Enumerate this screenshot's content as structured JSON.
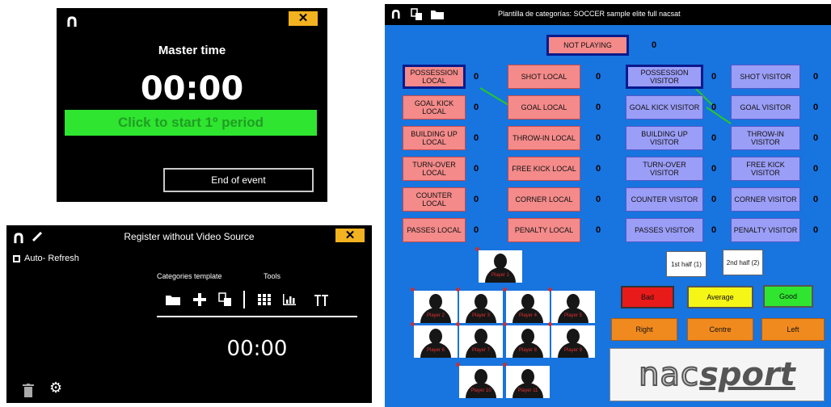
{
  "master": {
    "logo": "∩",
    "close": "✕",
    "title": "Master time",
    "clock": "00:00",
    "start_button": "Click to start 1º period",
    "end_button": "End of event"
  },
  "register": {
    "logo": "∩",
    "close": "✕",
    "title": "Register without Video Source",
    "auto_refresh": "Auto- Refresh",
    "categories_template": "Categories template",
    "tools": "Tools",
    "clock": "00:00",
    "icons": [
      "folder-icon",
      "plus-icon",
      "copy-icon",
      "grid-icon",
      "bar-chart-icon",
      "antenna-icon",
      "trash-icon",
      "gear-icon"
    ]
  },
  "template": {
    "title": "Plantilla de categorías: SOCCER sample elite full nacsat",
    "not_playing": {
      "label": "NOT PLAYING",
      "count": "0"
    },
    "local_a": [
      {
        "label": "POSSESSION LOCAL",
        "count": "0"
      },
      {
        "label": "GOAL KICK LOCAL",
        "count": "0"
      },
      {
        "label": "BUILDING UP LOCAL",
        "count": "0"
      },
      {
        "label": "TURN-OVER LOCAL",
        "count": "0"
      },
      {
        "label": "COUNTER LOCAL",
        "count": "0"
      },
      {
        "label": "PASSES LOCAL",
        "count": "0"
      }
    ],
    "local_b": [
      {
        "label": "SHOT LOCAL",
        "count": "0"
      },
      {
        "label": "GOAL LOCAL",
        "count": "0"
      },
      {
        "label": "THROW-IN LOCAL",
        "count": "0"
      },
      {
        "label": "FREE KICK LOCAL",
        "count": "0"
      },
      {
        "label": "CORNER LOCAL",
        "count": "0"
      },
      {
        "label": "PENALTY LOCAL",
        "count": "0"
      }
    ],
    "visitor_a": [
      {
        "label": "POSSESSION VISITOR",
        "count": "0"
      },
      {
        "label": "GOAL KICK VISITOR",
        "count": "0"
      },
      {
        "label": "BUILDING UP VISITOR",
        "count": "0"
      },
      {
        "label": "TURN-OVER VISITOR",
        "count": "0"
      },
      {
        "label": "COUNTER VISITOR",
        "count": "0"
      },
      {
        "label": "PASSES VISITOR",
        "count": "0"
      }
    ],
    "visitor_b": [
      {
        "label": "SHOT VISITOR",
        "count": "0"
      },
      {
        "label": "GOAL VISITOR",
        "count": "0"
      },
      {
        "label": "THROW-IN VISITOR",
        "count": "0"
      },
      {
        "label": "FREE KICK VISITOR",
        "count": "0"
      },
      {
        "label": "CORNER VISITOR",
        "count": "0"
      },
      {
        "label": "PENALTY VISITOR",
        "count": "0"
      }
    ],
    "first_half": "1st half (1)",
    "second_half": "2nd half (2)",
    "ratings": [
      {
        "label": "Bad",
        "color": "#e81a1a"
      },
      {
        "label": "Average",
        "color": "#f5f516"
      },
      {
        "label": "Good",
        "color": "#2fe52f"
      }
    ],
    "positions": [
      "Right",
      "Centre",
      "Left"
    ],
    "players": [
      "Player 1",
      "Player 2",
      "Player 3",
      "Player 4",
      "Player 5",
      "Player 6",
      "Player 7",
      "Player 8",
      "Player 9",
      "Player 10",
      "Player 11"
    ],
    "brand": {
      "prefix": "nac",
      "suffix": "sport"
    },
    "colors": {
      "background": "#1874de",
      "local": "#f48a8a",
      "visitor": "#9b9ef7",
      "position": "#f08a1e",
      "connector": "#28c828"
    }
  }
}
